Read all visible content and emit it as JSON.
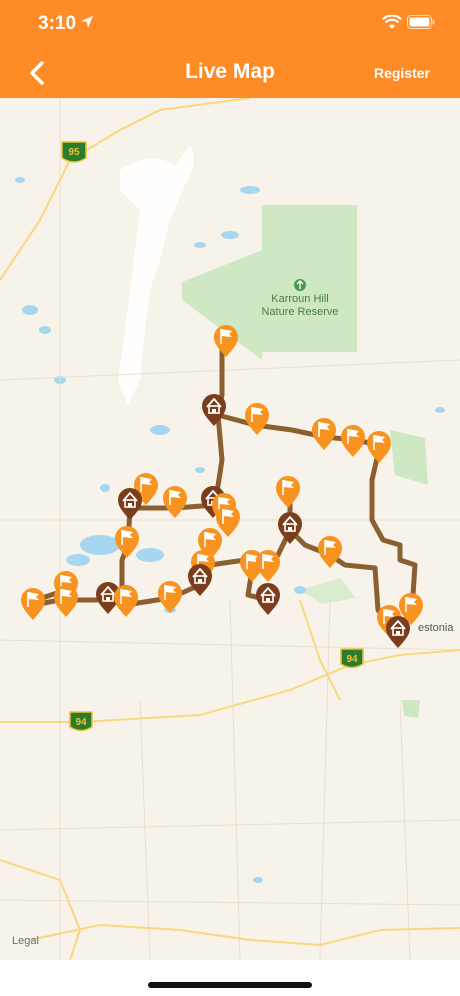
{
  "status": {
    "time": "3:10"
  },
  "nav": {
    "title": "Live Map",
    "register_label": "Register"
  },
  "map": {
    "reserve_label_line1": "Karroun Hill",
    "reserve_label_line2": "Nature Reserve",
    "town_label": "estonia",
    "shields": {
      "hwy95": "95",
      "hwy94_left": "94",
      "hwy94_right": "94"
    },
    "legal_label": "Legal",
    "colors": {
      "route": "#8c5f30",
      "flag_marker": "#f7931e",
      "house_marker": "#7b3d1b",
      "reserve": "#cfe8c4",
      "water": "#a6d6f0",
      "highway": "#f9d77e"
    }
  }
}
